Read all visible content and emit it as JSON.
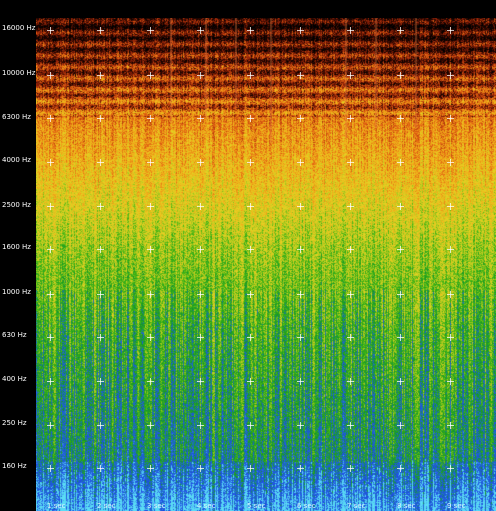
{
  "view": {
    "background": "#000000"
  },
  "frequency_axis": {
    "labels": [
      "16000 Hz",
      "10000 Hz",
      "6300 Hz",
      "4000 Hz",
      "2500 Hz",
      "1600 Hz",
      "1000 Hz",
      "630 Hz",
      "400 Hz",
      "250 Hz",
      "160 Hz"
    ],
    "scale": "log"
  },
  "time_axis": {
    "labels": [
      "1 sec",
      "2 sec",
      "3 sec",
      "4 sec",
      "5 sec",
      "6 sec",
      "7 sec",
      "8 sec",
      "9 sec"
    ]
  },
  "colormap": {
    "high": "#1a0500",
    "upper": "#c83c0a",
    "upper_mid": "#f0a018",
    "mid": "#e8d020",
    "lower_mid": "#3cb414",
    "low": "#1e6ed2",
    "lowest": "#50d2f0"
  }
}
